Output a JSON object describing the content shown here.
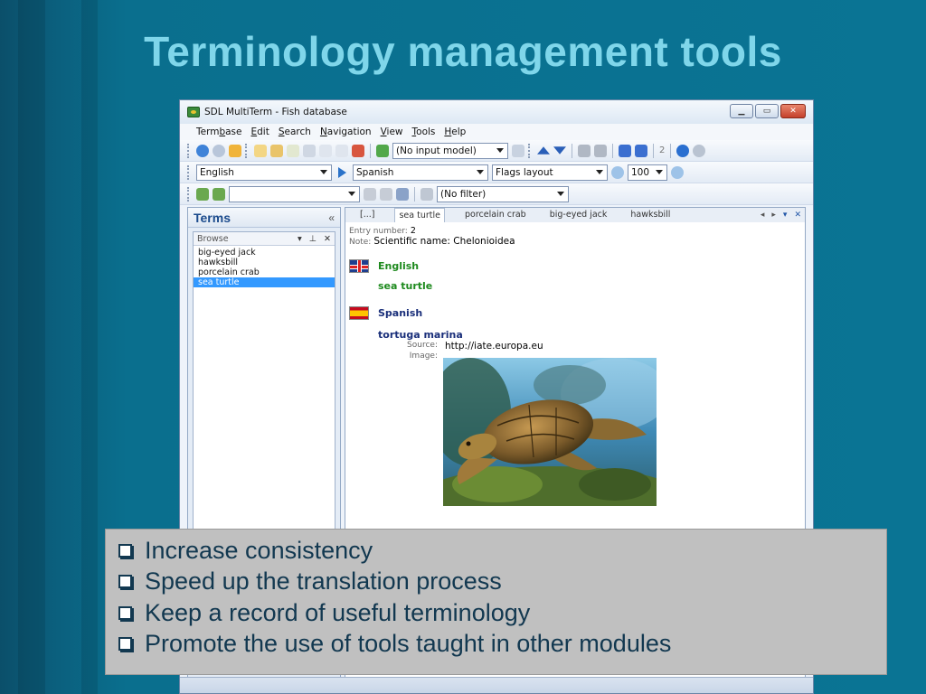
{
  "slide": {
    "title": "Terminology management tools",
    "bullets": [
      "Increase consistency",
      "Speed up the translation process",
      "Keep a record of useful terminology",
      "Promote the use of tools taught in other modules"
    ]
  },
  "app": {
    "title": "SDL MultiTerm - Fish database",
    "menu": [
      {
        "pre": "Term",
        "key": "b",
        "post": "ase"
      },
      {
        "pre": "",
        "key": "E",
        "post": "dit"
      },
      {
        "pre": "",
        "key": "S",
        "post": "earch"
      },
      {
        "pre": "",
        "key": "N",
        "post": "avigation"
      },
      {
        "pre": "",
        "key": "V",
        "post": "iew"
      },
      {
        "pre": "",
        "key": "T",
        "post": "ools"
      },
      {
        "pre": "",
        "key": "H",
        "post": "elp"
      }
    ],
    "input_model": "(No input model)",
    "nav_count": "2",
    "source_language": "English",
    "target_language": "Spanish",
    "layout": "Flags layout",
    "zoom": "100",
    "filter": "(No filter)",
    "search_value": ""
  },
  "terms_pane": {
    "title": "Terms",
    "collapse_glyph": "«",
    "browse_label": "Browse",
    "items": [
      "big-eyed jack",
      "hawksbill",
      "porcelain crab",
      "sea turtle"
    ],
    "selected_index": 3
  },
  "tabs": {
    "items": [
      "[...]",
      "sea turtle",
      "porcelain crab",
      "big-eyed jack",
      "hawksbill"
    ],
    "active_index": 1
  },
  "entry": {
    "number_label": "Entry number:",
    "number": "2",
    "note_label": "Note:",
    "note": "Scientific name: Chelonioidea",
    "english": {
      "language": "English",
      "term": "sea turtle"
    },
    "spanish": {
      "language": "Spanish",
      "term": "tortuga marina",
      "source_label": "Source:",
      "source": "http://iate.europa.eu",
      "image_label": "Image:"
    }
  },
  "colors": {
    "title": "#7fd6ea",
    "english_green": "#1e8a1e",
    "spanish_blue": "#1a2f7a",
    "selection": "#3399ff"
  }
}
